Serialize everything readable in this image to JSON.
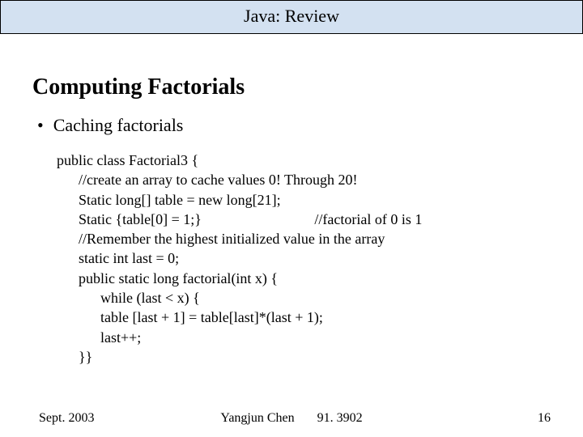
{
  "title": "Java: Review",
  "heading": "Computing Factorials",
  "bullet": "Caching factorials",
  "code": {
    "l1": "public class Factorial3 {",
    "l2": "      //create an array to cache values 0! Through 20!",
    "l3": "      Static long[] table = new long[21];",
    "l4": "      Static {table[0] = 1;}                               //factorial of 0 is 1",
    "l5": "      //Remember the highest initialized value in the array",
    "l6": "      static int last = 0;",
    "l7": "      public static long factorial(int x) {",
    "l8": "            while (last < x) {",
    "l9": "            table [last + 1] = table[last]*(last + 1);",
    "l10": "            last++;",
    "l11": "      }}"
  },
  "footer": {
    "left": "Sept. 2003",
    "center": "Yangjun Chen       91. 3902",
    "right": "16"
  }
}
